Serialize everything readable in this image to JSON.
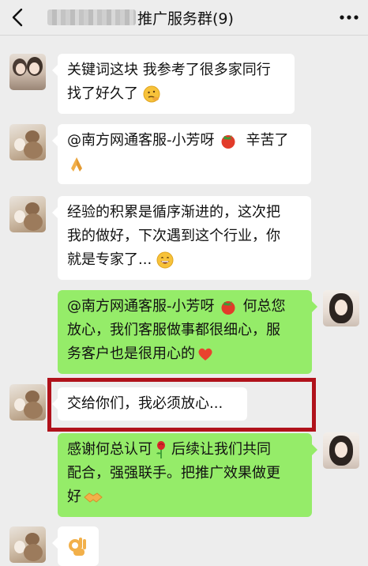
{
  "header": {
    "title": "推广服务群(9)",
    "blurred_name": "redacted"
  },
  "messages": [
    {
      "side": "in",
      "avatar": "girls-avatar",
      "line1": "关键词这块 我参考了很多家同行",
      "line2": "找了好久了",
      "emoji": "thinking-face-emoji"
    },
    {
      "side": "in",
      "avatar": "bear-avatar",
      "line1": "@南方网通客服-小芳呀",
      "line2": "辛苦了",
      "emoji1": "tomato-emoji",
      "emoji2": "praying-hands-emoji"
    },
    {
      "side": "in",
      "avatar": "bear-avatar",
      "line1": "经验的积累是循序渐进的，这次把",
      "line2": "我的做好，下次遇到这个行业，你",
      "line3": "就是专家了...",
      "emoji": "grinning-face-emoji"
    },
    {
      "side": "out",
      "avatar": "self-avatar",
      "line1": "@南方网通客服-小芳呀",
      "line1b": "何总您",
      "line2": "放心，我们客服做事都很细心，服",
      "line3": "务客户也是很用心的",
      "emoji1": "tomato-emoji",
      "emoji2": "heart-emoji"
    },
    {
      "side": "in",
      "avatar": "bear-avatar",
      "line1": "交给你们，我必须放心...",
      "highlighted": true
    },
    {
      "side": "out",
      "avatar": "self-avatar",
      "line1": "感谢何总认可",
      "line1b": "后续让我们共同",
      "line2": "配合，强强联手。把推广效果做更",
      "line3": "好",
      "emoji1": "rose-emoji",
      "emoji2": "handshake-emoji"
    },
    {
      "side": "in",
      "avatar": "bear-avatar",
      "emoji": "ok-hand-emoji"
    }
  ],
  "colors": {
    "background": "#ededed",
    "incoming_bubble": "#ffffff",
    "outgoing_bubble": "#95ec69",
    "highlight": "#b0121b"
  }
}
